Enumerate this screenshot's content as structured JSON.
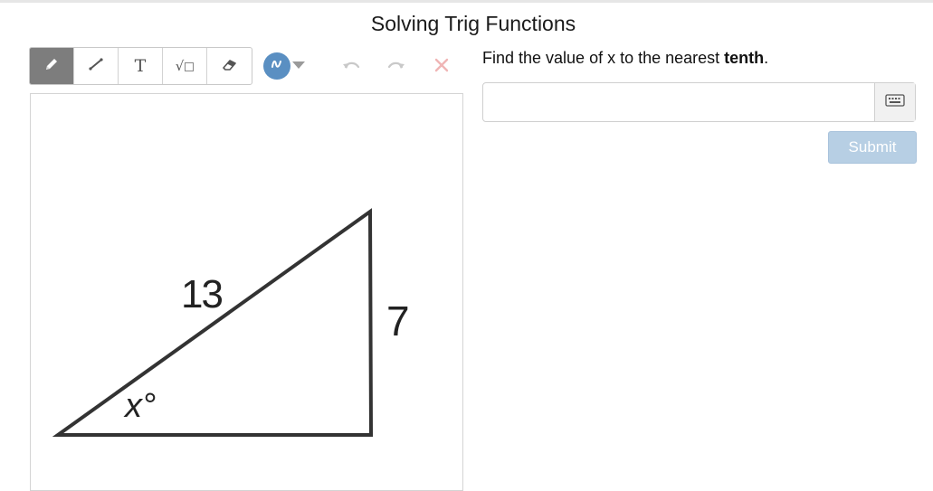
{
  "page": {
    "title": "Solving Trig Functions"
  },
  "toolbar": {
    "tools": [
      {
        "name": "pencil",
        "active": true
      },
      {
        "name": "line",
        "active": false
      },
      {
        "name": "text",
        "glyph": "T",
        "active": false
      },
      {
        "name": "math",
        "glyph": "√",
        "active": false
      },
      {
        "name": "eraser",
        "active": false
      }
    ],
    "color": {
      "value": "#5a8fc2"
    },
    "icons": [
      "pencil-icon",
      "line-icon",
      "text-icon",
      "sqrt-icon",
      "eraser-icon",
      "color-picker-icon",
      "undo-icon",
      "redo-icon",
      "clear-icon"
    ]
  },
  "figure": {
    "hypotenuse_label": "13",
    "opposite_label": "7",
    "angle_label": "x°"
  },
  "question": {
    "prefix": "Find the value of x to the nearest ",
    "emphasis": "tenth",
    "suffix": "."
  },
  "answer": {
    "value": "",
    "placeholder": ""
  },
  "submit": {
    "label": "Submit"
  },
  "colors": {
    "accent": "#5a8fc2",
    "submit_bg": "#b7cfe4",
    "active_tool": "#7d7d7d"
  }
}
